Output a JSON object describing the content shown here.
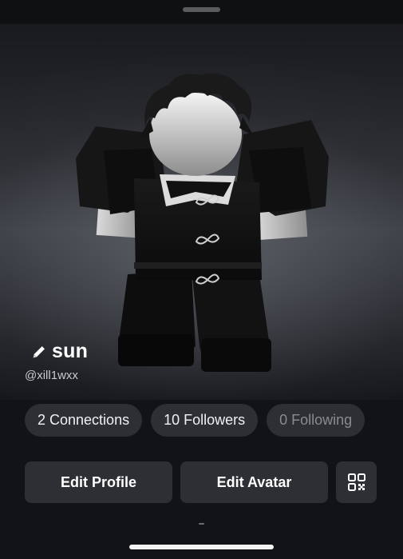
{
  "profile": {
    "display_name": "sun",
    "username": "@xill1wxx"
  },
  "stats": {
    "connections": "2 Connections",
    "followers": "10 Followers",
    "following": "0 Following"
  },
  "actions": {
    "edit_profile": "Edit Profile",
    "edit_avatar": "Edit Avatar",
    "qr_icon": "qr-code-icon"
  },
  "icons": {
    "edit": "pencil-icon"
  },
  "colors": {
    "background": "#121316",
    "pill": "#2d2f35",
    "muted_text": "#8a8b90"
  }
}
